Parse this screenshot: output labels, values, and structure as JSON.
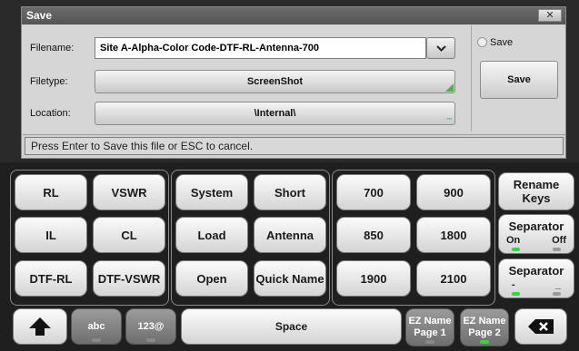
{
  "dialog": {
    "title": "Save",
    "close_icon": "close-x-icon",
    "filename_label": "Filename:",
    "filename_value": "Site A-Alpha-Color Code-DTF-RL-Antenna-700",
    "filetype_label": "Filetype:",
    "filetype_value": "ScreenShot",
    "location_label": "Location:",
    "location_value": "\\Internal\\",
    "save_checkbox_label": "Save",
    "save_button": "Save",
    "status_text": "Press Enter to Save this file or ESC to cancel."
  },
  "keys": {
    "group1": [
      "RL",
      "VSWR",
      "IL",
      "CL",
      "DTF-RL",
      "DTF-VSWR"
    ],
    "group2": [
      "System",
      "Short",
      "Load",
      "Antenna",
      "Open",
      "Quick Name"
    ],
    "group3": [
      "700",
      "900",
      "850",
      "1800",
      "1900",
      "2100"
    ],
    "rename_keys": "Rename Keys",
    "separator1_title": "Separator",
    "separator1_on": "On",
    "separator1_off": "Off",
    "separator2_title": "Separator",
    "separator2_left": "-",
    "separator2_right": "_"
  },
  "bottom": {
    "shift_icon": "shift-up-arrow-icon",
    "abc": "abc",
    "num": "123@",
    "space": "Space",
    "ez1_line1": "EZ Name",
    "ez1_line2": "Page 1",
    "ez2_line1": "EZ Name",
    "ez2_line2": "Page 2",
    "backspace_icon": "backspace-icon"
  },
  "colors": {
    "indicator_on": "#3fcf3f",
    "accent_green": "#4db34d"
  }
}
